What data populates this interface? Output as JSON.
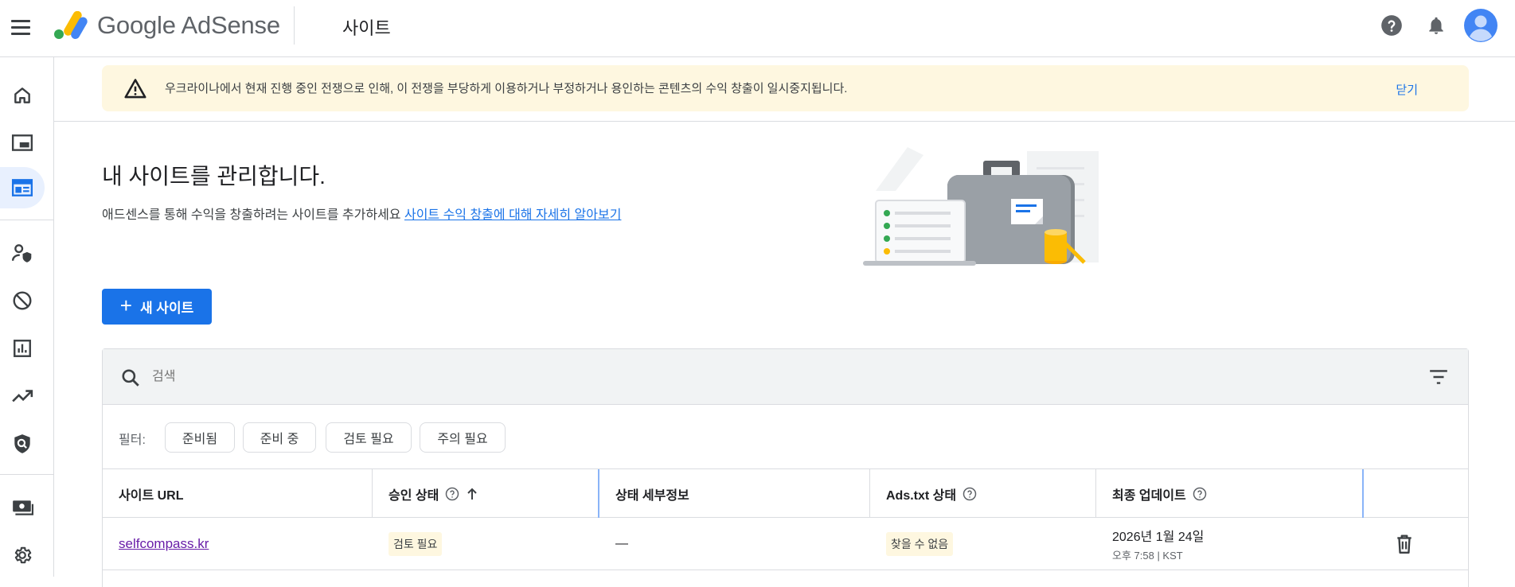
{
  "header": {
    "brand": "Google AdSense",
    "page_title": "사이트",
    "icons": [
      "menu-icon",
      "help-icon",
      "notifications-icon",
      "account-avatar"
    ]
  },
  "rail": {
    "items": [
      "home-icon",
      "ads-icon",
      "sites-icon",
      "privacy-messaging-icon",
      "blocking-controls-icon",
      "reports-icon",
      "optimization-icon",
      "policy-center-icon",
      "payments-icon",
      "settings-icon"
    ],
    "active": "sites-icon"
  },
  "banner": {
    "message": "우크라이나에서 현재 진행 중인 전쟁으로 인해, 이 전쟁을 부당하게 이용하거나 부정하거나 용인하는 콘텐츠의 수익 창출이 일시중지됩니다.",
    "close": "닫기"
  },
  "main": {
    "title": "내 사이트를 관리합니다.",
    "subtitle": "애드센스를 통해 수익을 창출하려는 사이트를 추가하세요",
    "learn_more": "사이트 수익 창출에 대해 자세히 알아보기",
    "new_site": "새 사이트"
  },
  "search": {
    "placeholder": "검색"
  },
  "filters": {
    "label": "필터:",
    "chips": [
      "준비됨",
      "준비 중",
      "검토 필요",
      "주의 필요"
    ]
  },
  "table": {
    "headers": [
      "사이트 URL",
      "승인 상태",
      "상태 세부정보",
      "Ads.txt 상태",
      "최종 업데이트"
    ],
    "rows": [
      {
        "url": "selfcompass.kr",
        "approval": "검토 필요",
        "details": "—",
        "ads_txt": "찾을 수 없음",
        "updated_date": "2026년 1월 24일",
        "updated_time": "오후 7:58 | KST"
      }
    ]
  },
  "colors": {
    "primary": "#1a73e8",
    "banner_bg": "#fef7e0",
    "visited_link": "#681da8",
    "rail_active_bg": "#e8f0fe"
  }
}
